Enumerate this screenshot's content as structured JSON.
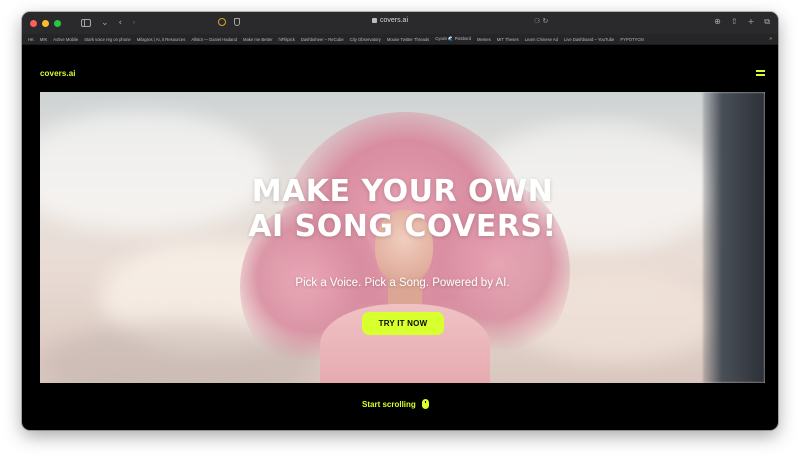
{
  "browser": {
    "address": "covers.ai",
    "bookmarks": [
      "HK",
      "MIK",
      "Active Mobile",
      "Stark voice reg on phone",
      "Milagros | AI, it Resources",
      "Allstot — Daniel Hadand",
      "Make me Better",
      "hiFlitpick",
      "Dashboheer – ReCube",
      "City Observatory",
      "Mouse Twitter Threads",
      "Cyaim 🌊 Pissbord",
      "Memes",
      "MIT Theses",
      "Learn Chinese Ad",
      "Live Dashboard – YouTube",
      "PYPOTYCM"
    ],
    "more_bookmarks": "»"
  },
  "site": {
    "logo": "covers.ai"
  },
  "hero": {
    "title_line1": "MAKE YOUR OWN",
    "title_line2": "AI SONG COVERS!",
    "subtitle": "Pick a Voice. Pick a Song. Powered by AI.",
    "cta_label": "TRY IT NOW"
  },
  "footer": {
    "scroll_label": "Start scrolling"
  },
  "colors": {
    "accent": "#d8ff2e",
    "background": "#000000"
  }
}
